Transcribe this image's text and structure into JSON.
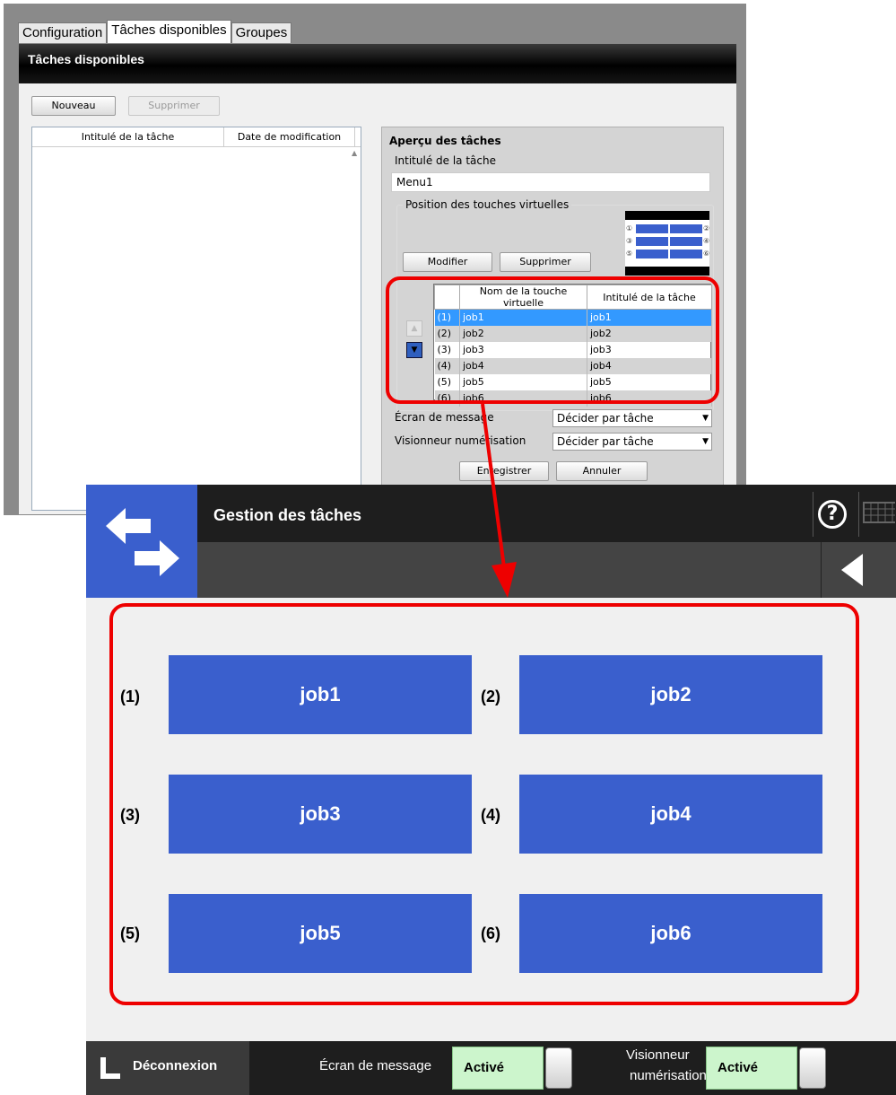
{
  "admin": {
    "tabs": [
      "Configuration",
      "Tâches disponibles",
      "Groupes"
    ],
    "title": "Tâches disponibles",
    "new_button": "Nouveau",
    "delete_button": "Supprimer",
    "list_columns": [
      "Intitulé de la tâche",
      "Date de modification"
    ],
    "preview": {
      "title": "Aperçu des tâches",
      "task_label": "Intitulé de la tâche",
      "task_value": "Menu1",
      "position_legend": "Position des touches virtuelles",
      "modify_button": "Modifier",
      "delete_button": "Supprimer",
      "mini_numbers": [
        "①",
        "②",
        "③",
        "④",
        "⑤",
        "⑥"
      ],
      "grid_columns": [
        "Nom de la touche virtuelle",
        "Intitulé de la tâche"
      ],
      "rows": [
        {
          "num": "(1)",
          "name": "job1",
          "task": "job1"
        },
        {
          "num": "(2)",
          "name": "job2",
          "task": "job2"
        },
        {
          "num": "(3)",
          "name": "job3",
          "task": "job3"
        },
        {
          "num": "(4)",
          "name": "job4",
          "task": "job4"
        },
        {
          "num": "(5)",
          "name": "job5",
          "task": "job5"
        },
        {
          "num": "(6)",
          "name": "job6",
          "task": "job6"
        }
      ],
      "message_label": "Écran de message",
      "message_value": "Décider par tâche",
      "viewer_label": "Visionneur numérisation",
      "viewer_value": "Décider par tâche",
      "save_button": "Enregistrer",
      "cancel_button": "Annuler"
    }
  },
  "panel": {
    "title": "Gestion des tâches",
    "help_symbol": "?",
    "jobs": [
      {
        "num": "(1)",
        "label": "job1"
      },
      {
        "num": "(2)",
        "label": "job2"
      },
      {
        "num": "(3)",
        "label": "job3"
      },
      {
        "num": "(4)",
        "label": "job4"
      },
      {
        "num": "(5)",
        "label": "job5"
      },
      {
        "num": "(6)",
        "label": "job6"
      }
    ],
    "footer": {
      "logout": "Déconnexion",
      "message_label": "Écran de message",
      "message_state": "Activé",
      "viewer_label_line1": "Visionneur",
      "viewer_label_line2": "numérisation",
      "viewer_state": "Activé"
    }
  },
  "colors": {
    "accent_blue": "#3a5fcd",
    "callout_red": "#e00000",
    "selected_row": "#3399ff",
    "toggle_green": "#ccf5cc"
  }
}
